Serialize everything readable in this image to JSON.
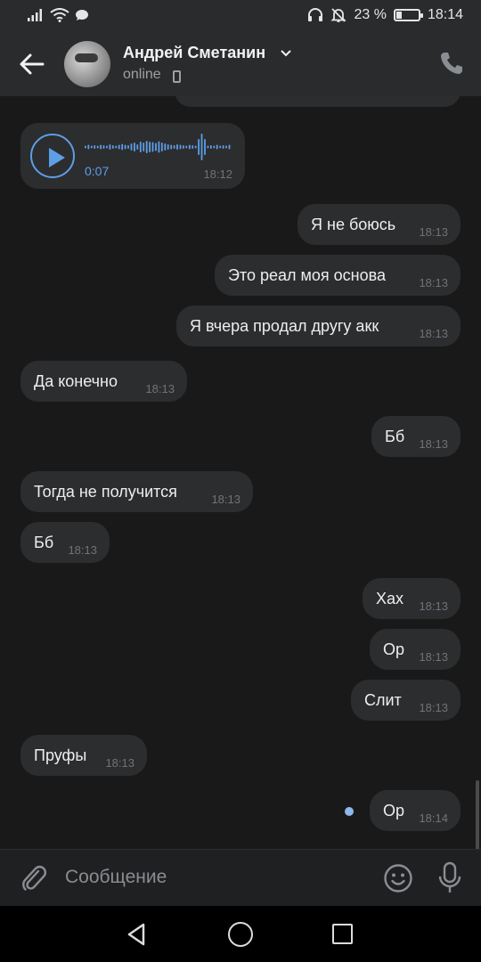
{
  "status_bar": {
    "battery_percent": "23 %",
    "battery_level": 0.23,
    "time": "18:14",
    "icons": [
      "signal-icon",
      "wifi-icon",
      "chat-notification-icon",
      "headphones-icon",
      "mute-icon",
      "battery-icon"
    ]
  },
  "header": {
    "contact_name": "Андрей Сметанин",
    "status": "online",
    "icons": [
      "back-arrow-icon",
      "chevron-down-icon",
      "mobile-device-icon",
      "phone-icon"
    ]
  },
  "voice_message": {
    "duration": "0:07",
    "time": "18:12"
  },
  "messages": [
    {
      "text": "Я не боюсь",
      "time": "18:13",
      "outgoing": true
    },
    {
      "text": "Это реал моя основа",
      "time": "18:13",
      "outgoing": true
    },
    {
      "text": "Я вчера продал другу акк",
      "time": "18:13",
      "outgoing": true
    },
    {
      "text": "Да конечно",
      "time": "18:13",
      "outgoing": false
    },
    {
      "text": "Бб",
      "time": "18:13",
      "outgoing": true
    },
    {
      "text": "Тогда не получится",
      "time": "18:13",
      "outgoing": false
    },
    {
      "text": "Бб",
      "time": "18:13",
      "outgoing": false
    },
    {
      "text": "Хах",
      "time": "18:13",
      "outgoing": true
    },
    {
      "text": "Ор",
      "time": "18:13",
      "outgoing": true
    },
    {
      "text": "Слит",
      "time": "18:13",
      "outgoing": true
    },
    {
      "text": "Пруфы",
      "time": "18:13",
      "outgoing": false
    },
    {
      "text": "Ор",
      "time": "18:14",
      "outgoing": true,
      "unread": true
    }
  ],
  "composer": {
    "placeholder": "Сообщение",
    "icons": [
      "paperclip-icon",
      "emoji-icon",
      "microphone-icon"
    ]
  },
  "nav_bar": {
    "icons": [
      "nav-back-icon",
      "nav-home-icon",
      "nav-recents-icon"
    ]
  }
}
